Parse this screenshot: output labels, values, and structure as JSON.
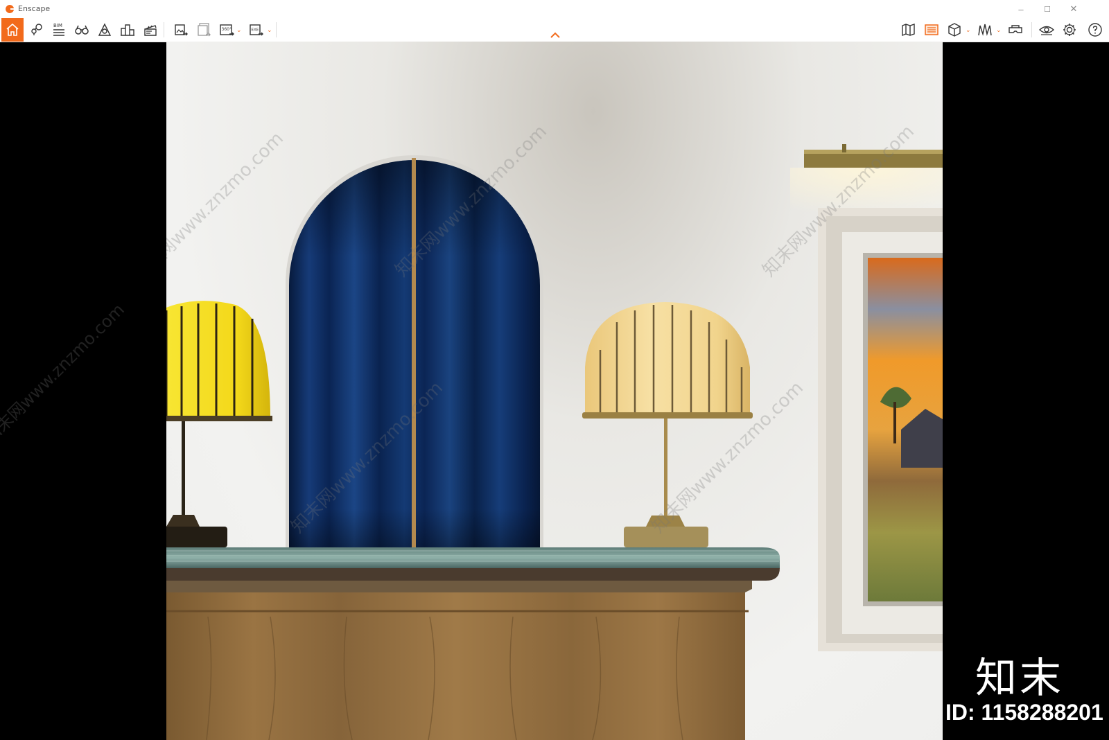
{
  "window": {
    "title": "Enscape",
    "minimize": "–",
    "maximize": "☐",
    "close": "✕"
  },
  "toolbar": {
    "left_buttons": [
      {
        "name": "home-button",
        "icon": "home-icon",
        "active": true
      },
      {
        "name": "views-button",
        "icon": "location-pin-icon"
      },
      {
        "name": "bim-button",
        "icon": "bim-icon",
        "label": "BIM"
      },
      {
        "name": "binoculars-button",
        "icon": "binoculars-icon"
      },
      {
        "name": "asset-library-button",
        "icon": "asset-library-icon"
      },
      {
        "name": "site-context-button",
        "icon": "buildings-icon"
      },
      {
        "name": "video-editor-button",
        "icon": "clapperboard-icon"
      }
    ],
    "export_buttons": [
      {
        "name": "render-image-button",
        "icon": "render-image-icon"
      },
      {
        "name": "batch-render-button",
        "icon": "batch-render-icon"
      },
      {
        "name": "panorama-button",
        "icon": "panorama-360-icon",
        "label": "360°"
      },
      {
        "name": "export-exe-button",
        "icon": "export-exe-icon",
        "label": "EXE"
      }
    ],
    "right_buttons": [
      {
        "name": "map-button",
        "icon": "map-icon"
      },
      {
        "name": "visual-settings-button",
        "icon": "visual-settings-icon"
      },
      {
        "name": "section-box-button",
        "icon": "cube-icon"
      },
      {
        "name": "atmosphere-button",
        "icon": "atmosphere-icon"
      },
      {
        "name": "vr-headset-button",
        "icon": "vr-headset-icon"
      },
      {
        "name": "view-button",
        "icon": "eye-icon"
      },
      {
        "name": "settings-button",
        "icon": "gear-icon"
      },
      {
        "name": "help-button",
        "icon": "help-icon"
      }
    ],
    "dropdown_caret": "⌄"
  },
  "colors": {
    "accent": "#f26a1b",
    "curtain": "#0d2a5a",
    "lamp_yellow": "#f4dd22",
    "lamp_cream": "#f1d38a",
    "brass": "#a88b4c",
    "wood": "#8e6a3c"
  },
  "watermark": {
    "text": "知末网www.znzmo.com",
    "brand": "知末",
    "id_label": "ID: 1158288201"
  }
}
